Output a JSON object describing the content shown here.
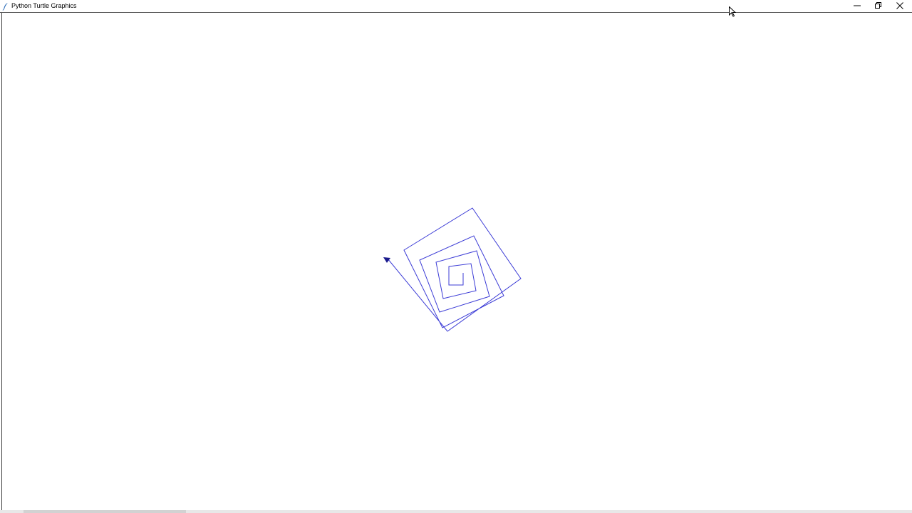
{
  "window": {
    "title": "Python Turtle Graphics",
    "controls": {
      "minimize": "minimize",
      "maximize": "restore",
      "close": "close"
    }
  },
  "canvas": {
    "background": "#ffffff",
    "pen_color": "#3b3bd6",
    "turtle_color": "#1a1a8c"
  },
  "icons": {
    "app": "feather-icon",
    "minimize": "minimize-icon",
    "restore": "restore-icon",
    "close": "close-icon",
    "cursor": "mouse-pointer-icon",
    "turtle": "turtle-arrow-icon"
  }
}
